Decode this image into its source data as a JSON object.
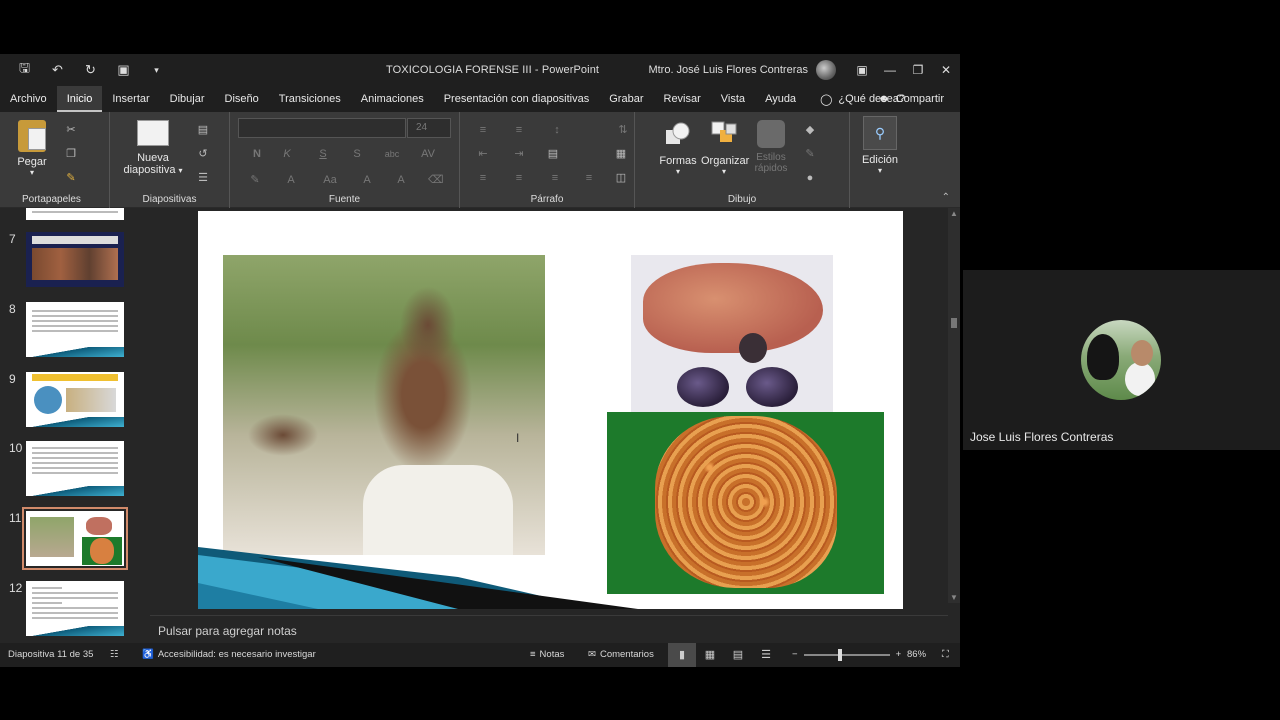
{
  "window": {
    "title": "TOXICOLOGIA FORENSE III  -  PowerPoint",
    "user": "Mtro. José Luis Flores Contreras"
  },
  "tabs": [
    "Archivo",
    "Inicio",
    "Insertar",
    "Dibujar",
    "Diseño",
    "Transiciones",
    "Animaciones",
    "Presentación con diapositivas",
    "Grabar",
    "Revisar",
    "Vista",
    "Ayuda"
  ],
  "tellme": "¿Qué desea?",
  "share": "Compartir",
  "ribbon": {
    "paste": "Pegar",
    "new_slide_line1": "Nueva",
    "new_slide_line2": "diapositiva",
    "font_size": "24",
    "shapes": "Formas",
    "arrange": "Organizar",
    "quick_styles_line1": "Estilos",
    "quick_styles_line2": "rápidos",
    "editing": "Edición",
    "groups": {
      "clipboard": "Portapapeles",
      "slides": "Diapositivas",
      "font": "Fuente",
      "paragraph": "Párrafo",
      "drawing": "Dibujo"
    }
  },
  "thumbnails": [
    "7",
    "8",
    "9",
    "10",
    "11",
    "12"
  ],
  "selected_slide": "11",
  "notes_placeholder": "Pulsar para agregar notas",
  "status": {
    "slide_counter": "Diapositiva 11 de 35",
    "accessibility": "Accesibilidad: es necesario investigar",
    "notes": "Notas",
    "comments": "Comentarios",
    "zoom": "86%"
  },
  "participant": {
    "name": "Jose Luis Flores Contreras"
  },
  "colors": {
    "titlebar": "#1f1f1f",
    "ribbon": "#3a3a3a",
    "canvas": "#262626",
    "slide_accent": "#1d7a2b",
    "thumb_selected_outline": "#d08a6a"
  }
}
